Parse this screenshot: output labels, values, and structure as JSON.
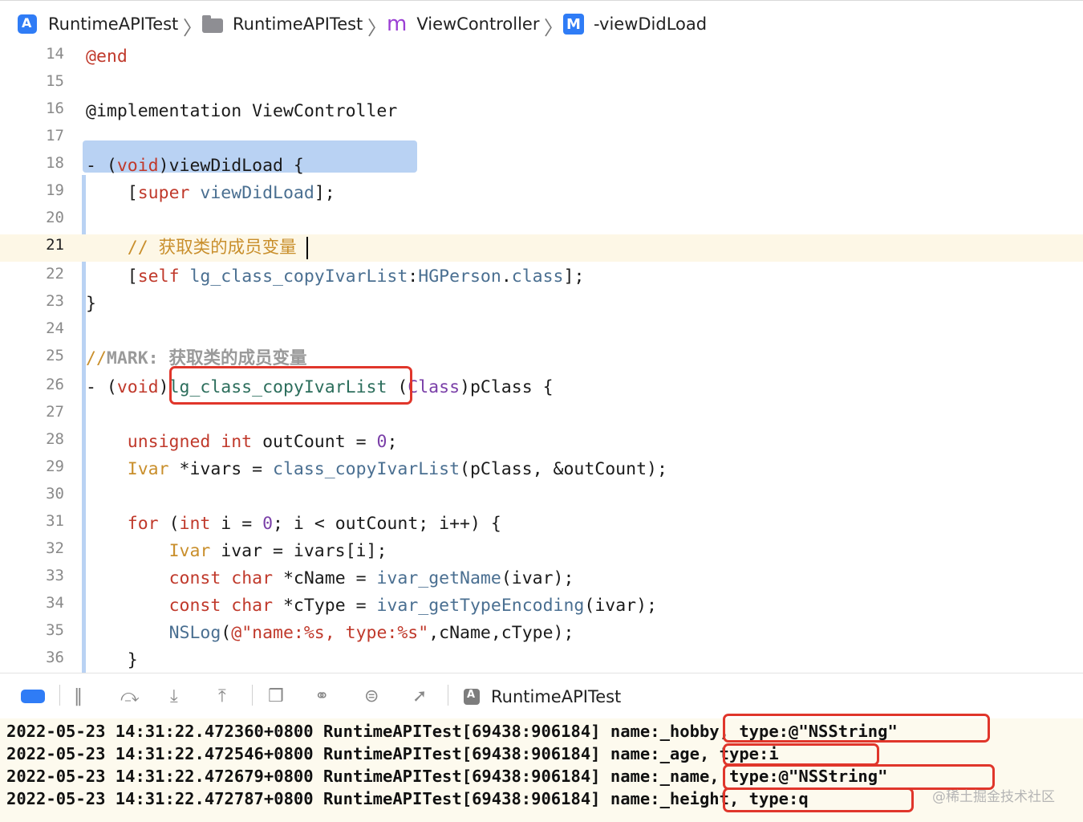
{
  "breadcrumb": {
    "items": [
      {
        "label": "RuntimeAPITest",
        "icon": "app-target-icon"
      },
      {
        "label": "RuntimeAPITest",
        "icon": "folder-icon"
      },
      {
        "label": "ViewController",
        "icon": "m-file-icon"
      },
      {
        "label": "-viewDidLoad",
        "icon": "method-icon"
      }
    ],
    "separator": "〉",
    "m_glyph": "m",
    "method_glyph": "M"
  },
  "editor": {
    "current_line": 21,
    "lines": [
      {
        "n": "14"
      },
      {
        "n": "15"
      },
      {
        "n": "16"
      },
      {
        "n": "17"
      },
      {
        "n": "18"
      },
      {
        "n": "19"
      },
      {
        "n": "20"
      },
      {
        "n": "21"
      },
      {
        "n": "22"
      },
      {
        "n": "23"
      },
      {
        "n": "24"
      },
      {
        "n": "25"
      },
      {
        "n": "26"
      },
      {
        "n": "27"
      },
      {
        "n": "28"
      },
      {
        "n": "29"
      },
      {
        "n": "30"
      },
      {
        "n": "31"
      },
      {
        "n": "32"
      },
      {
        "n": "33"
      },
      {
        "n": "34"
      },
      {
        "n": "35"
      },
      {
        "n": "36"
      }
    ],
    "code": {
      "l14": "@end",
      "l16": "@implementation ViewController",
      "l18_dash": "- ",
      "l18_open": "(",
      "l18_void": "void",
      "l18_rest": ")viewDidLoad {",
      "l19_open": "    [",
      "l19_super": "super",
      "l19_sp": " ",
      "l19_fn": "viewDidLoad",
      "l19_close": "];",
      "l21_comment": "    // 获取类的成员变量",
      "l22_open": "    [",
      "l22_self": "self",
      "l22_sp": " ",
      "l22_fn": "lg_class_copyIvarList",
      "l22_colon": ":",
      "l22_cls": "HGPerson",
      "l22_dot": ".",
      "l22_class": "class",
      "l22_close": "];",
      "l23": "}",
      "l25_slashes": "//",
      "l25_mark": "MARK: 获取类的成员变量",
      "l26_dash": "- ",
      "l26_open": "(",
      "l26_void": "void",
      "l26_close": ")",
      "l26_fn": "lg_class_copyIvarList",
      "l26_sp": " (",
      "l26_class": "Class",
      "l26_rest": ")pClass {",
      "l28_indent": "    ",
      "l28_unsigned": "unsigned",
      "l28_sp": " ",
      "l28_int": "int",
      "l28_mid": " outCount = ",
      "l28_zero": "0",
      "l28_end": ";",
      "l29_indent": "    ",
      "l29_ivar": "Ivar",
      "l29_mid": " *ivars = ",
      "l29_fn": "class_copyIvarList",
      "l29_rest": "(pClass, &outCount);",
      "l31_indent": "    ",
      "l31_for": "for",
      "l31_open": " (",
      "l31_int": "int",
      "l31_mid": " i = ",
      "l31_zero": "0",
      "l31_rest": "; i < outCount; i++) {",
      "l32_indent": "        ",
      "l32_ivar": "Ivar",
      "l32_rest": " ivar = ivars[i];",
      "l33_indent": "        ",
      "l33_const": "const",
      "l33_sp": " ",
      "l33_char": "char",
      "l33_mid": " *cName = ",
      "l33_fn": "ivar_getName",
      "l33_rest": "(ivar);",
      "l34_indent": "        ",
      "l34_const": "const",
      "l34_sp": " ",
      "l34_char": "char",
      "l34_mid": " *cType = ",
      "l34_fn": "ivar_getTypeEncoding",
      "l34_rest": "(ivar);",
      "l35_indent": "        ",
      "l35_fn": "NSLog",
      "l35_open": "(",
      "l35_str": "@\"name:%s, type:%s\"",
      "l35_rest": ",cName,cType);",
      "l36": "    }"
    }
  },
  "debugbar": {
    "target_label": "RuntimeAPITest",
    "icons": [
      "breakpoints-toggle-icon",
      "pause-icon",
      "step-over-icon",
      "step-into-icon",
      "step-out-icon",
      "view-hierarchy-icon",
      "memory-graph-icon",
      "environment-overrides-icon",
      "simulate-location-icon",
      "app-target-icon"
    ]
  },
  "console": {
    "lines": [
      {
        "prefix": "2022-05-23 14:31:22.472360+0800 RuntimeAPITest[69438:906184] name:",
        "detail": "_hobby, type:@\"NSString\""
      },
      {
        "prefix": "2022-05-23 14:31:22.472546+0800 RuntimeAPITest[69438:906184] name:",
        "detail": "_age, type:i"
      },
      {
        "prefix": "2022-05-23 14:31:22.472679+0800 RuntimeAPITest[69438:906184] name:",
        "detail": "_name, type:@\"NSString\""
      },
      {
        "prefix": "2022-05-23 14:31:22.472787+0800 RuntimeAPITest[69438:906184] name:",
        "detail": "_height, type:q"
      }
    ]
  },
  "watermark": "@稀土掘金技术社区",
  "colors": {
    "keyword": "#c0392b",
    "class": "#7a3fa8",
    "function": "#4a6f91",
    "comment": "#c98f2c",
    "highlight_box": "#e0362b",
    "selection": "#b9d2f3",
    "current_line": "#fdf7e6",
    "console_bg": "#fdfaee"
  }
}
